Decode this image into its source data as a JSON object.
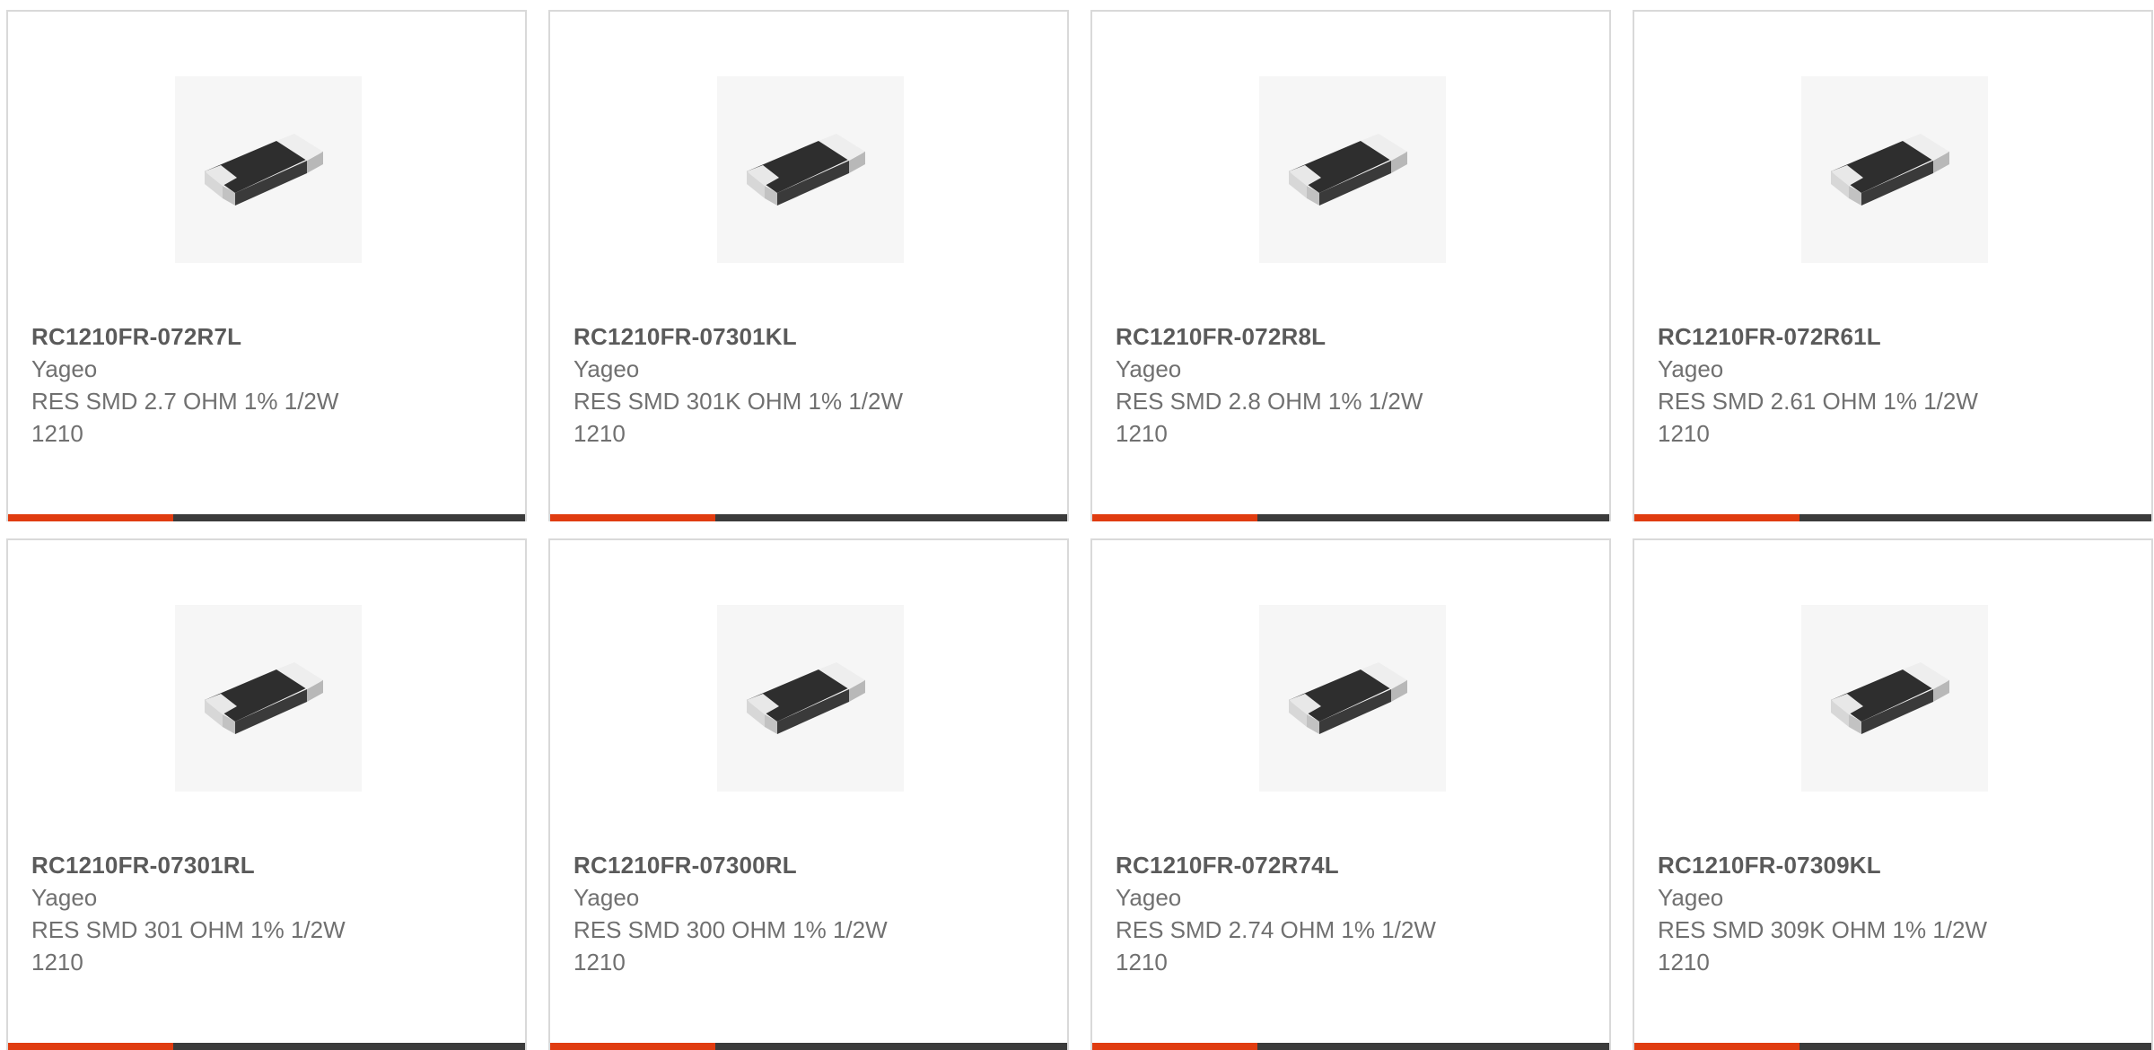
{
  "products": [
    {
      "part_number": "RC1210FR-072R7L",
      "manufacturer": "Yageo",
      "description": "RES SMD 2.7 OHM 1% 1/2W",
      "package": "1210",
      "image_icon": "chip-resistor-icon"
    },
    {
      "part_number": "RC1210FR-07301KL",
      "manufacturer": "Yageo",
      "description": "RES SMD 301K OHM 1% 1/2W",
      "package": "1210",
      "image_icon": "chip-resistor-icon"
    },
    {
      "part_number": "RC1210FR-072R8L",
      "manufacturer": "Yageo",
      "description": "RES SMD 2.8 OHM 1% 1/2W",
      "package": "1210",
      "image_icon": "chip-resistor-icon"
    },
    {
      "part_number": "RC1210FR-072R61L",
      "manufacturer": "Yageo",
      "description": "RES SMD 2.61 OHM 1% 1/2W",
      "package": "1210",
      "image_icon": "chip-resistor-icon"
    },
    {
      "part_number": "RC1210FR-07301RL",
      "manufacturer": "Yageo",
      "description": "RES SMD 301 OHM 1% 1/2W",
      "package": "1210",
      "image_icon": "chip-resistor-icon"
    },
    {
      "part_number": "RC1210FR-07300RL",
      "manufacturer": "Yageo",
      "description": "RES SMD 300 OHM 1% 1/2W",
      "package": "1210",
      "image_icon": "chip-resistor-icon"
    },
    {
      "part_number": "RC1210FR-072R74L",
      "manufacturer": "Yageo",
      "description": "RES SMD 2.74 OHM 1% 1/2W",
      "package": "1210",
      "image_icon": "chip-resistor-icon"
    },
    {
      "part_number": "RC1210FR-07309KL",
      "manufacturer": "Yageo",
      "description": "RES SMD 309K OHM 1% 1/2W",
      "package": "1210",
      "image_icon": "chip-resistor-icon"
    }
  ],
  "colors": {
    "accent": "#e03c10",
    "bar_dark": "#3b3b3b",
    "card_border": "#d9d9d9",
    "part_text": "#5a5a5a",
    "body_text": "#707070"
  }
}
